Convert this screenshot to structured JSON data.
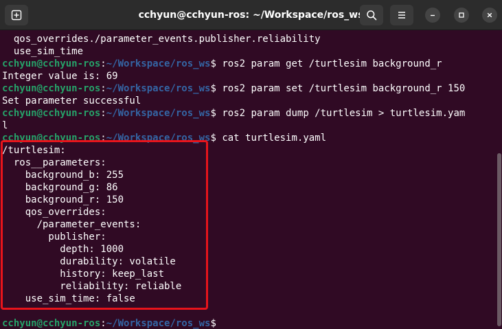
{
  "window": {
    "title": "cchyun@cchyun-ros: ~/Workspace/ros_ws"
  },
  "titlebar": {
    "new_tab_icon": "new-tab-icon",
    "search_icon": "search-icon",
    "menu_icon": "hamburger-menu-icon",
    "minimize_icon": "minimize-icon",
    "maximize_icon": "maximize-icon",
    "close_icon": "close-icon"
  },
  "prompt": {
    "user": "cchyun@cchyun-ros",
    "sep": ":",
    "path": "~/Workspace/ros_ws",
    "sign": "$"
  },
  "terminal": {
    "lines": [
      {
        "type": "output",
        "text": "  qos_overrides./parameter_events.publisher.reliability"
      },
      {
        "type": "output",
        "text": "  use_sim_time"
      },
      {
        "type": "prompt",
        "cmd": " ros2 param get /turtlesim background_r"
      },
      {
        "type": "output",
        "text": "Integer value is: 69"
      },
      {
        "type": "prompt",
        "cmd": " ros2 param set /turtlesim background_r 150"
      },
      {
        "type": "output",
        "text": "Set parameter successful"
      },
      {
        "type": "prompt",
        "cmd": " ros2 param dump /turtlesim > turtlesim.yam"
      },
      {
        "type": "output",
        "text": "l"
      },
      {
        "type": "prompt",
        "cmd": " cat turtlesim.yaml"
      },
      {
        "type": "output",
        "text": "/turtlesim:"
      },
      {
        "type": "output",
        "text": "  ros__parameters:"
      },
      {
        "type": "output",
        "text": "    background_b: 255"
      },
      {
        "type": "output",
        "text": "    background_g: 86"
      },
      {
        "type": "output",
        "text": "    background_r: 150"
      },
      {
        "type": "output",
        "text": "    qos_overrides:"
      },
      {
        "type": "output",
        "text": "      /parameter_events:"
      },
      {
        "type": "output",
        "text": "        publisher:"
      },
      {
        "type": "output",
        "text": "          depth: 1000"
      },
      {
        "type": "output",
        "text": "          durability: volatile"
      },
      {
        "type": "output",
        "text": "          history: keep_last"
      },
      {
        "type": "output",
        "text": "          reliability: reliable"
      },
      {
        "type": "output",
        "text": "    use_sim_time: false"
      },
      {
        "type": "blank",
        "text": ""
      },
      {
        "type": "prompt",
        "cmd": ""
      }
    ]
  },
  "colors": {
    "background": "#300a24",
    "prompt_user": "#26a269",
    "prompt_path": "#3465a4",
    "highlight_box": "#e8141b"
  }
}
